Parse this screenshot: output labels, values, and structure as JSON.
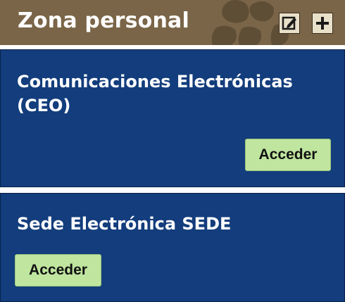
{
  "header": {
    "title": "Zona personal",
    "edit_icon": "edit-icon",
    "add_icon": "plus-icon"
  },
  "cards": [
    {
      "title": "Comunicaciones Electrónicas (CEO)",
      "button_label": "Acceder"
    },
    {
      "title": "Sede Electrónica SEDE",
      "button_label": "Acceder"
    }
  ],
  "colors": {
    "header_bg": "#7a6548",
    "card_bg": "#133d7c",
    "button_bg": "#bfe59f"
  }
}
